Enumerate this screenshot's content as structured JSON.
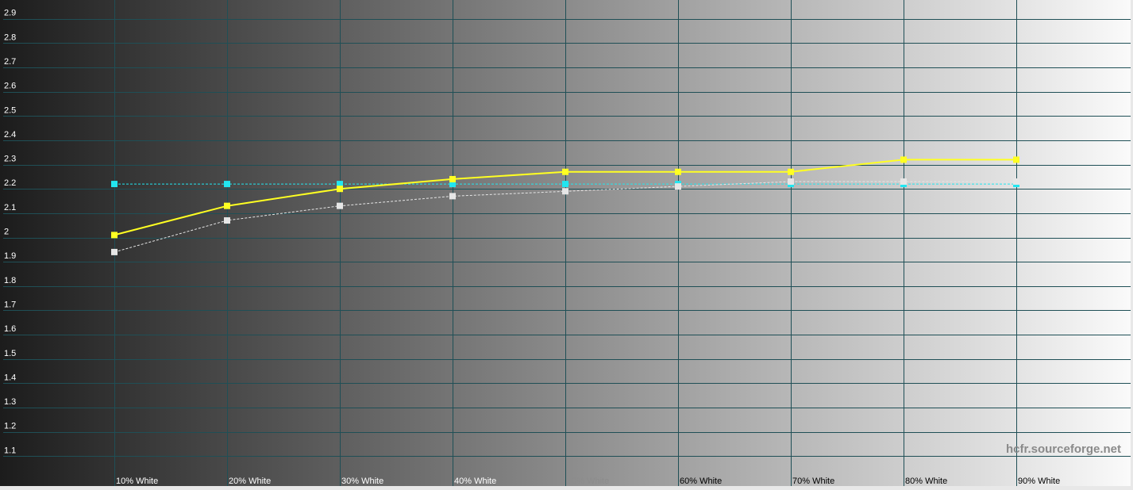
{
  "chart_data": {
    "type": "line",
    "title": "",
    "xlabel": "",
    "ylabel": "",
    "categories": [
      "10% White",
      "20% White",
      "30% White",
      "40% White",
      "50% White",
      "60% White",
      "70% White",
      "80% White",
      "90% White"
    ],
    "ylim": [
      1.0,
      3.0
    ],
    "yticks": [
      "1.1",
      "1.2",
      "1.3",
      "1.4",
      "1.5",
      "1.6",
      "1.7",
      "1.8",
      "1.9",
      "2",
      "2.1",
      "2.2",
      "2.3",
      "2.4",
      "2.5",
      "2.6",
      "2.7",
      "2.8",
      "2.9"
    ],
    "grid": true,
    "background": "grayscale-gradient",
    "series": [
      {
        "color": "#ffff22",
        "style": "solid",
        "values": [
          2.01,
          2.13,
          2.2,
          2.24,
          2.27,
          2.27,
          2.27,
          2.32,
          2.32
        ]
      },
      {
        "color": "#e6e6e6",
        "style": "dashed",
        "values": [
          1.94,
          2.07,
          2.13,
          2.17,
          2.19,
          2.21,
          2.23,
          2.23,
          2.23
        ]
      },
      {
        "color": "#22e6f0",
        "style": "dashed",
        "values": [
          2.22,
          2.22,
          2.22,
          2.22,
          2.22,
          2.22,
          2.22,
          2.22,
          2.22
        ]
      }
    ]
  },
  "watermark": "hcfr.sourceforge.net",
  "colors": {
    "grid": "#1f4f56"
  }
}
